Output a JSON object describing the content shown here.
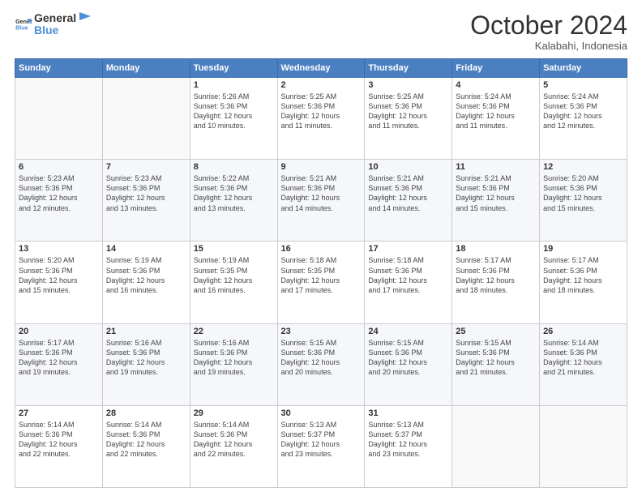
{
  "header": {
    "title": "October 2024",
    "location": "Kalabahi, Indonesia",
    "logo_general": "General",
    "logo_blue": "Blue"
  },
  "calendar": {
    "days": [
      "Sunday",
      "Monday",
      "Tuesday",
      "Wednesday",
      "Thursday",
      "Friday",
      "Saturday"
    ],
    "weeks": [
      [
        {
          "day": "",
          "info": ""
        },
        {
          "day": "",
          "info": ""
        },
        {
          "day": "1",
          "info": "Sunrise: 5:26 AM\nSunset: 5:36 PM\nDaylight: 12 hours\nand 10 minutes."
        },
        {
          "day": "2",
          "info": "Sunrise: 5:25 AM\nSunset: 5:36 PM\nDaylight: 12 hours\nand 11 minutes."
        },
        {
          "day": "3",
          "info": "Sunrise: 5:25 AM\nSunset: 5:36 PM\nDaylight: 12 hours\nand 11 minutes."
        },
        {
          "day": "4",
          "info": "Sunrise: 5:24 AM\nSunset: 5:36 PM\nDaylight: 12 hours\nand 11 minutes."
        },
        {
          "day": "5",
          "info": "Sunrise: 5:24 AM\nSunset: 5:36 PM\nDaylight: 12 hours\nand 12 minutes."
        }
      ],
      [
        {
          "day": "6",
          "info": "Sunrise: 5:23 AM\nSunset: 5:36 PM\nDaylight: 12 hours\nand 12 minutes."
        },
        {
          "day": "7",
          "info": "Sunrise: 5:23 AM\nSunset: 5:36 PM\nDaylight: 12 hours\nand 13 minutes."
        },
        {
          "day": "8",
          "info": "Sunrise: 5:22 AM\nSunset: 5:36 PM\nDaylight: 12 hours\nand 13 minutes."
        },
        {
          "day": "9",
          "info": "Sunrise: 5:21 AM\nSunset: 5:36 PM\nDaylight: 12 hours\nand 14 minutes."
        },
        {
          "day": "10",
          "info": "Sunrise: 5:21 AM\nSunset: 5:36 PM\nDaylight: 12 hours\nand 14 minutes."
        },
        {
          "day": "11",
          "info": "Sunrise: 5:21 AM\nSunset: 5:36 PM\nDaylight: 12 hours\nand 15 minutes."
        },
        {
          "day": "12",
          "info": "Sunrise: 5:20 AM\nSunset: 5:36 PM\nDaylight: 12 hours\nand 15 minutes."
        }
      ],
      [
        {
          "day": "13",
          "info": "Sunrise: 5:20 AM\nSunset: 5:36 PM\nDaylight: 12 hours\nand 15 minutes."
        },
        {
          "day": "14",
          "info": "Sunrise: 5:19 AM\nSunset: 5:36 PM\nDaylight: 12 hours\nand 16 minutes."
        },
        {
          "day": "15",
          "info": "Sunrise: 5:19 AM\nSunset: 5:35 PM\nDaylight: 12 hours\nand 16 minutes."
        },
        {
          "day": "16",
          "info": "Sunrise: 5:18 AM\nSunset: 5:35 PM\nDaylight: 12 hours\nand 17 minutes."
        },
        {
          "day": "17",
          "info": "Sunrise: 5:18 AM\nSunset: 5:36 PM\nDaylight: 12 hours\nand 17 minutes."
        },
        {
          "day": "18",
          "info": "Sunrise: 5:17 AM\nSunset: 5:36 PM\nDaylight: 12 hours\nand 18 minutes."
        },
        {
          "day": "19",
          "info": "Sunrise: 5:17 AM\nSunset: 5:36 PM\nDaylight: 12 hours\nand 18 minutes."
        }
      ],
      [
        {
          "day": "20",
          "info": "Sunrise: 5:17 AM\nSunset: 5:36 PM\nDaylight: 12 hours\nand 19 minutes."
        },
        {
          "day": "21",
          "info": "Sunrise: 5:16 AM\nSunset: 5:36 PM\nDaylight: 12 hours\nand 19 minutes."
        },
        {
          "day": "22",
          "info": "Sunrise: 5:16 AM\nSunset: 5:36 PM\nDaylight: 12 hours\nand 19 minutes."
        },
        {
          "day": "23",
          "info": "Sunrise: 5:15 AM\nSunset: 5:36 PM\nDaylight: 12 hours\nand 20 minutes."
        },
        {
          "day": "24",
          "info": "Sunrise: 5:15 AM\nSunset: 5:36 PM\nDaylight: 12 hours\nand 20 minutes."
        },
        {
          "day": "25",
          "info": "Sunrise: 5:15 AM\nSunset: 5:36 PM\nDaylight: 12 hours\nand 21 minutes."
        },
        {
          "day": "26",
          "info": "Sunrise: 5:14 AM\nSunset: 5:36 PM\nDaylight: 12 hours\nand 21 minutes."
        }
      ],
      [
        {
          "day": "27",
          "info": "Sunrise: 5:14 AM\nSunset: 5:36 PM\nDaylight: 12 hours\nand 22 minutes."
        },
        {
          "day": "28",
          "info": "Sunrise: 5:14 AM\nSunset: 5:36 PM\nDaylight: 12 hours\nand 22 minutes."
        },
        {
          "day": "29",
          "info": "Sunrise: 5:14 AM\nSunset: 5:36 PM\nDaylight: 12 hours\nand 22 minutes."
        },
        {
          "day": "30",
          "info": "Sunrise: 5:13 AM\nSunset: 5:37 PM\nDaylight: 12 hours\nand 23 minutes."
        },
        {
          "day": "31",
          "info": "Sunrise: 5:13 AM\nSunset: 5:37 PM\nDaylight: 12 hours\nand 23 minutes."
        },
        {
          "day": "",
          "info": ""
        },
        {
          "day": "",
          "info": ""
        }
      ]
    ]
  }
}
